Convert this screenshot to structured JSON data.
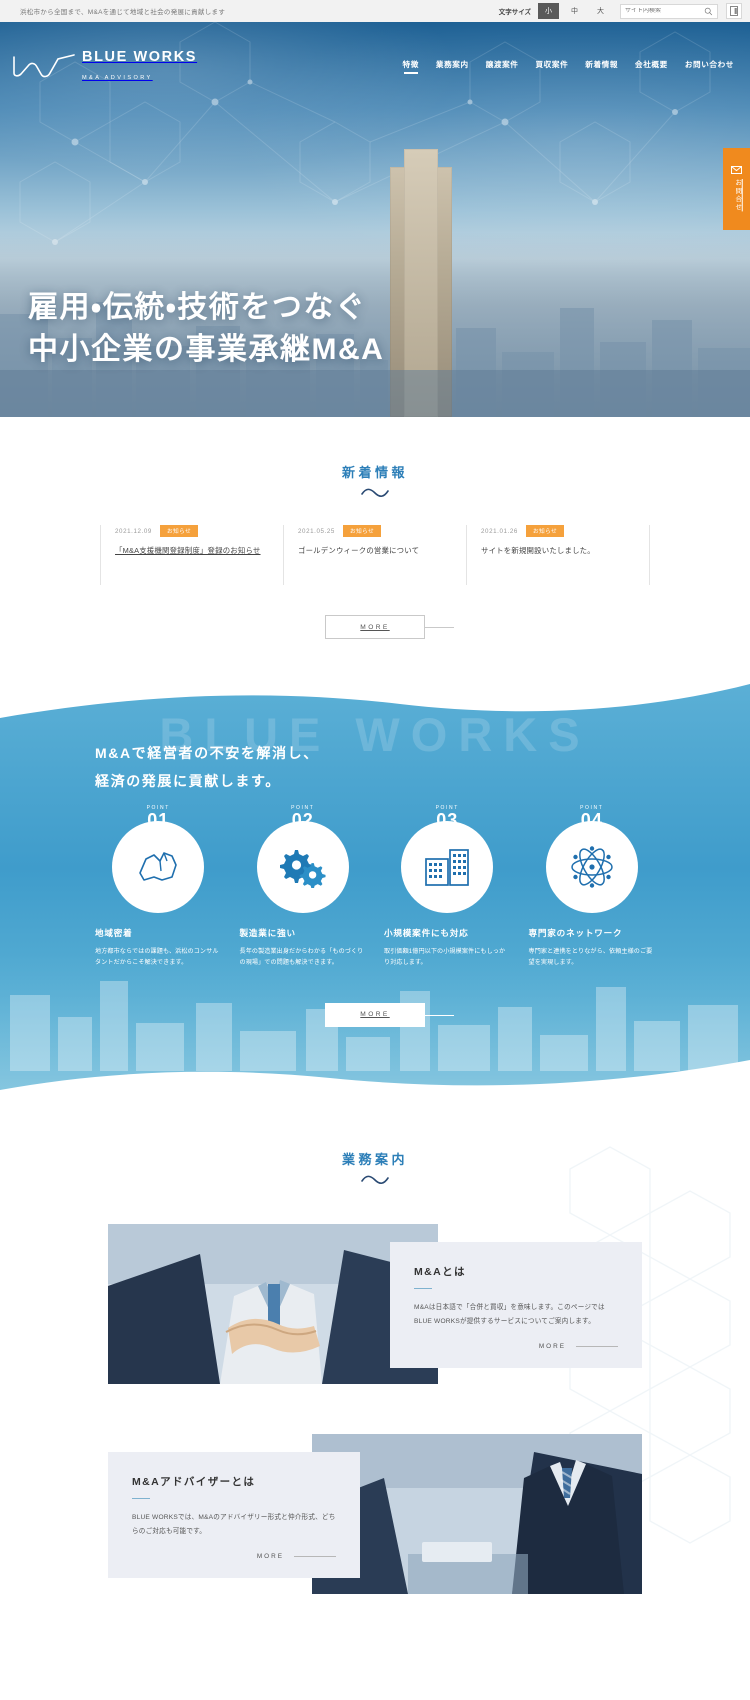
{
  "utilbar": {
    "tagline": "浜松市から全国まで、M&Aを通じて地域と社会の発展に貢献します",
    "fontsize_label": "文字サイズ",
    "fontsize_options": [
      "小",
      "中",
      "大"
    ],
    "fontsize_active": "小",
    "search_placeholder": "サイト内検索",
    "search_value": "",
    "search_icon": "search-icon",
    "panel_icon": "panel-toggle-icon"
  },
  "header": {
    "logo_title": "BLUE WORKS",
    "logo_sub": "M&A ADVISORY",
    "nav": [
      {
        "label": "特徴",
        "active": true
      },
      {
        "label": "業務案内",
        "active": false
      },
      {
        "label": "譲渡案件",
        "active": false
      },
      {
        "label": "買収案件",
        "active": false
      },
      {
        "label": "新着情報",
        "active": false
      },
      {
        "label": "会社概要",
        "active": false
      },
      {
        "label": "お問い合わせ",
        "active": false
      }
    ],
    "contact_tab": {
      "label": "お問合せ",
      "icon": "mail-icon",
      "color": "#f08a1e"
    }
  },
  "hero": {
    "line1": "雇用・伝統・技術をつなぐ",
    "line2": "中小企業の事業承継M&A"
  },
  "news": {
    "title": "新着情報",
    "items": [
      {
        "date": "2021.12.09",
        "badge": "お知らせ",
        "title": "「M&A支援機関登録制度」登録のお知らせ",
        "is_link": true
      },
      {
        "date": "2021.05.25",
        "badge": "お知らせ",
        "title": "ゴールデンウィークの営業について",
        "is_link": false
      },
      {
        "date": "2021.01.26",
        "badge": "お知らせ",
        "title": "サイトを新規開設いたしました。",
        "is_link": false
      }
    ],
    "more_label": "MORE"
  },
  "point_section": {
    "ghost_text": "BLUE WORKS",
    "heading_line1": "M&Aで経営者の不安を解消し、",
    "heading_line2": "経済の発展に貢献します。",
    "points": [
      {
        "word": "POINT",
        "num": "01",
        "icon": "map-shape-icon",
        "title": "地域密着",
        "body": "地方都市ならではの課題も、浜松のコンサルタントだからこそ解決できます。"
      },
      {
        "word": "POINT",
        "num": "02",
        "icon": "gears-icon",
        "title": "製造業に強い",
        "body": "長年の製造業出身だからわかる「ものづくりの現場」での問題も解決できます。"
      },
      {
        "word": "POINT",
        "num": "03",
        "icon": "buildings-icon",
        "title": "小規模案件にも対応",
        "body": "取引価額1億円以下の小規模案件にもしっかり対応します。"
      },
      {
        "word": "POINT",
        "num": "04",
        "icon": "network-atom-icon",
        "title": "専門家のネットワーク",
        "body": "専門家と連携をとりながら、依頼主様のご要望を実現します。"
      }
    ],
    "more_label": "MORE"
  },
  "service_section": {
    "title": "業務案内",
    "cards": [
      {
        "image_name": "handshake-photo",
        "title": "M&Aとは",
        "body": "M&Aは日本語で「合併と買収」を意味します。このページではBLUE WORKSが提供するサービスについてご案内します。",
        "more_label": "MORE",
        "layout": "image-left"
      },
      {
        "image_name": "meeting-photo",
        "title": "M&Aアドバイザーとは",
        "body": "BLUE WORKSでは、M&Aのアドバイザリー形式と仲介形式、どちらのご対応も可能です。",
        "more_label": "MORE",
        "layout": "image-right"
      }
    ]
  },
  "colors": {
    "brand_blue": "#2d7fb8",
    "accent_orange": "#f08a1e",
    "badge_orange": "#f5a13c",
    "band_blue": "#3f9ccb",
    "card_gray": "#eceef4"
  }
}
